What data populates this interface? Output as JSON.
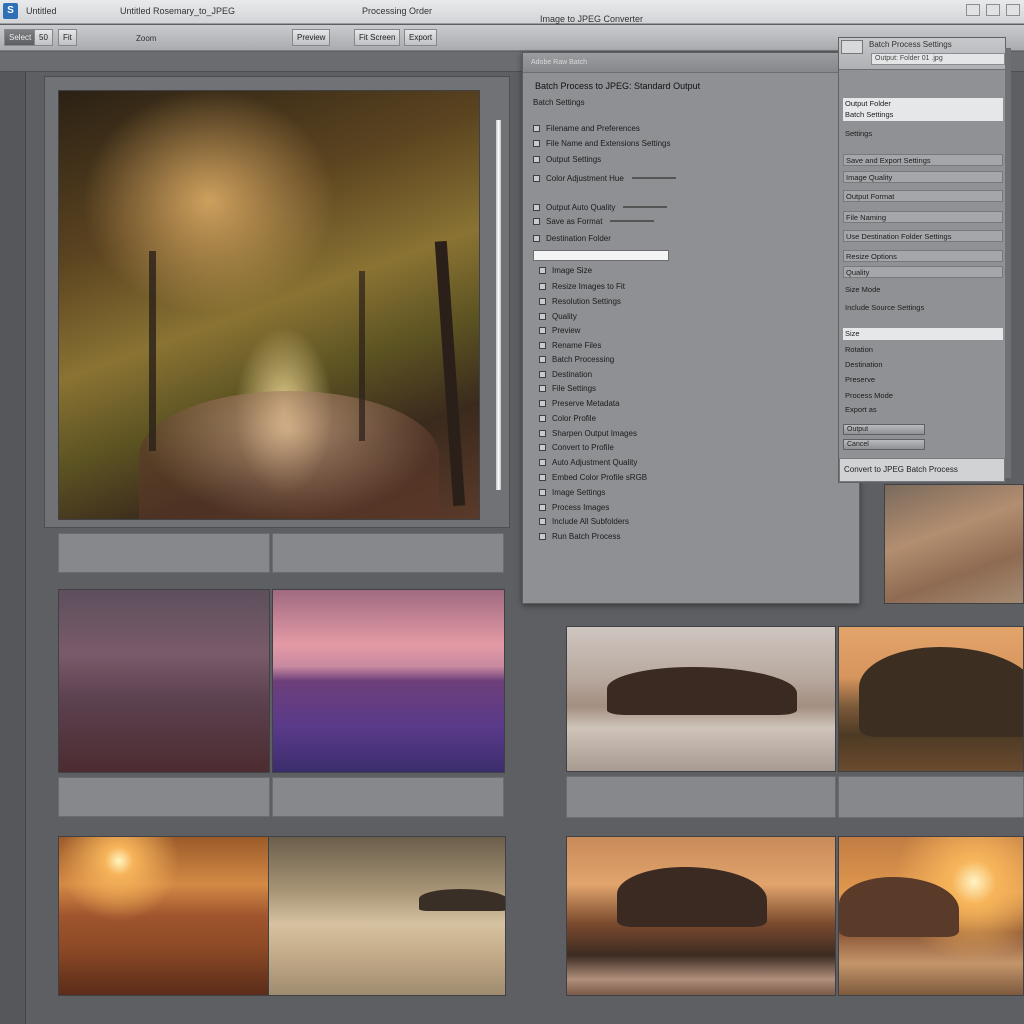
{
  "window": {
    "app_icon": "S",
    "title_left": "Untitled",
    "title_mid": "Untitled  Rosemary_to_JPEG",
    "title_right": "Processing Order",
    "title_far": "Image to JPEG Converter"
  },
  "toolbar": {
    "btn1": "Select",
    "btn2": "50",
    "btn3": "Fit",
    "label1": "Zoom",
    "btn4": "Preview",
    "btn5": "Fit Screen",
    "btn6": "Export"
  },
  "dialog": {
    "header": "Adobe Raw Batch",
    "title": "Batch Process to JPEG: Standard Output",
    "subtitle": "Batch Settings",
    "rows": [
      {
        "text": "Filename and Preferences",
        "check": true
      },
      {
        "text": "File Name and Extensions Settings",
        "check": false
      },
      {
        "text": "Output Settings",
        "check": false
      },
      {
        "text": "Color Adjustment Hue",
        "check": false,
        "slider": true
      },
      {
        "text": "Output Auto Quality",
        "check": false,
        "slider": true
      },
      {
        "text": "Save as Format",
        "check": false,
        "slider": true
      },
      {
        "text": "Destination Folder",
        "check": false
      },
      {
        "text": "Image Size",
        "check": true
      },
      {
        "text": "Resize Images to Fit",
        "check": true
      },
      {
        "text": "Resolution Settings",
        "check": true
      },
      {
        "text": "Quality",
        "check": true
      },
      {
        "text": "Preview",
        "check": true
      },
      {
        "text": "Rename Files",
        "check": true
      },
      {
        "text": "Batch Processing",
        "check": true
      },
      {
        "text": "Destination",
        "check": true
      },
      {
        "text": "File Settings",
        "check": true
      },
      {
        "text": "Preserve Metadata",
        "check": true
      },
      {
        "text": "Color Profile",
        "check": true
      },
      {
        "text": "Sharpen Output Images",
        "check": true
      },
      {
        "text": "Convert to Profile",
        "check": true
      },
      {
        "text": "Auto Adjustment Quality",
        "check": true
      },
      {
        "text": "Embed Color Profile sRGB",
        "check": true
      },
      {
        "text": "Image Settings",
        "check": true
      },
      {
        "text": "Process Images",
        "check": true
      },
      {
        "text": "Include All Subfolders",
        "check": true
      },
      {
        "text": "Run Batch Process",
        "check": true
      }
    ]
  },
  "rpanel": {
    "title": "Batch Process Settings",
    "path": "Output: Folder 01 .jpg",
    "rows": [
      {
        "text": "Output Folder",
        "sel": true
      },
      {
        "text": "Batch Settings",
        "sel": true
      },
      {
        "text": "Settings",
        "sel": false
      },
      {
        "text": "Save and Export Settings",
        "sel": false,
        "field": true
      },
      {
        "text": "Image Quality",
        "sel": false,
        "field": true
      },
      {
        "text": "Output Format",
        "sel": false,
        "field": true
      },
      {
        "text": "File Naming",
        "sel": false,
        "field": true
      },
      {
        "text": "Use Destination Folder Settings",
        "sel": false,
        "field": true
      },
      {
        "text": "Resize Options",
        "sel": false,
        "field": true
      },
      {
        "text": "Quality",
        "sel": false,
        "field": true
      },
      {
        "text": "Size Mode",
        "sel": false
      },
      {
        "text": "Include Source Settings",
        "sel": false
      },
      {
        "text": "Size",
        "sel": true
      },
      {
        "text": "Rotation",
        "sel": false
      },
      {
        "text": "Destination",
        "sel": false
      },
      {
        "text": "Preserve",
        "sel": false
      },
      {
        "text": "Process Mode",
        "sel": false
      },
      {
        "text": "Export as",
        "sel": false
      }
    ],
    "btn1": "Output",
    "btn2": "Cancel",
    "bottom": "Convert to JPEG Batch Process"
  }
}
